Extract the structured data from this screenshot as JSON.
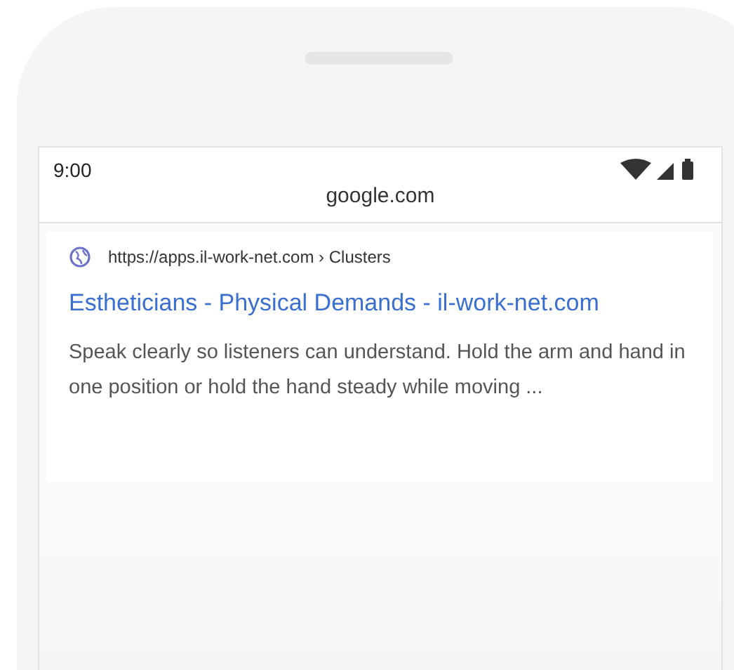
{
  "status_bar": {
    "time": "9:00"
  },
  "address_bar": {
    "domain": "google.com"
  },
  "result": {
    "breadcrumb": "https://apps.il-work-net.com › Clusters",
    "title": "Estheticians - Physical Demands - il-work-net.com",
    "snippet": "Speak clearly so listeners can understand. Hold the arm and hand in one position or hold the hand steady while moving ..."
  }
}
